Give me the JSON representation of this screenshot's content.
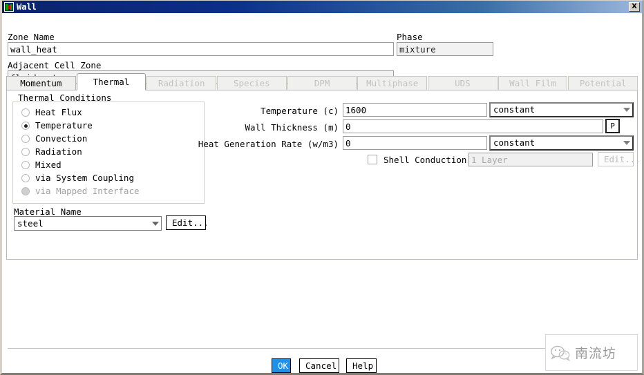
{
  "window": {
    "title": "Wall",
    "icon": "fluent-app-icon",
    "close_label": "X"
  },
  "header": {
    "zone_name_label": "Zone Name",
    "zone_name_value": "wall_heat",
    "phase_label": "Phase",
    "phase_value": "mixture",
    "adjacent_label": "Adjacent Cell Zone",
    "adjacent_value": "fluid_water"
  },
  "tabs": [
    {
      "label": "Momentum",
      "state": "enabled"
    },
    {
      "label": "Thermal",
      "state": "selected"
    },
    {
      "label": "Radiation",
      "state": "disabled"
    },
    {
      "label": "Species",
      "state": "disabled"
    },
    {
      "label": "DPM",
      "state": "disabled"
    },
    {
      "label": "Multiphase",
      "state": "disabled"
    },
    {
      "label": "UDS",
      "state": "disabled"
    },
    {
      "label": "Wall Film",
      "state": "disabled"
    },
    {
      "label": "Potential",
      "state": "disabled"
    }
  ],
  "thermal": {
    "group_label": "Thermal Conditions",
    "conditions": [
      {
        "label": "Heat Flux",
        "selected": false,
        "disabled": false
      },
      {
        "label": "Temperature",
        "selected": true,
        "disabled": false
      },
      {
        "label": "Convection",
        "selected": false,
        "disabled": false
      },
      {
        "label": "Radiation",
        "selected": false,
        "disabled": false
      },
      {
        "label": "Mixed",
        "selected": false,
        "disabled": false
      },
      {
        "label": "via System Coupling",
        "selected": false,
        "disabled": false
      },
      {
        "label": "via Mapped Interface",
        "selected": false,
        "disabled": true
      }
    ],
    "material_label": "Material Name",
    "material_value": "steel",
    "material_edit_label": "Edit...",
    "temperature_label": "Temperature (c)",
    "temperature_value": "1600",
    "temperature_profile": "constant",
    "thickness_label": "Wall Thickness (m)",
    "thickness_value": "0",
    "thickness_param_label": "P",
    "heatgen_label": "Heat Generation Rate (w/m3)",
    "heatgen_value": "0",
    "heatgen_profile": "constant",
    "shell_conduction_label": "Shell Conduction",
    "shell_conduction_checked": false,
    "shell_layers_value": "1 Layer",
    "shell_edit_label": "Edit..."
  },
  "footer": {
    "ok_label": "OK",
    "cancel_label": "Cancel",
    "help_label": "Help"
  },
  "watermark": {
    "icon": "wechat-icon",
    "text": "南流坊"
  }
}
